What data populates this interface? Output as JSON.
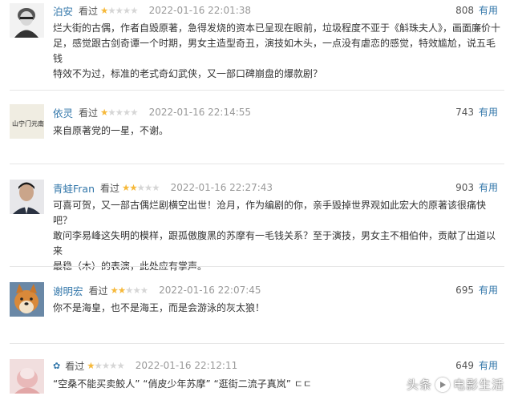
{
  "comments": [
    {
      "username": "泊安",
      "status": "看过",
      "rating": 1,
      "time": "2022-01-16 22:01:38",
      "votes": "808",
      "useful_label": "有用",
      "avatar_icon": "portrait-avatar-icon",
      "lines": [
        "烂大街的古偶，作者自毁原著，急得发烧的资本已呈现在眼前，垃圾程度不亚于《斛珠夫人》，画面廉价十",
        "足，感觉跟古剑奇谭一个时期，男女主造型奇丑，演技如木头，一点没有虐恋的感觉，特效尴尬，说五毛钱",
        "特效不为过，标准的老式奇幻武侠，又一部口碑崩盘的爆款剧？"
      ]
    },
    {
      "username": "依灵",
      "status": "看过",
      "rating": 1,
      "time": "2022-01-16 22:14:55",
      "votes": "743",
      "useful_label": "有用",
      "avatar_icon": "calligraphy-avatar-icon",
      "lines": [
        "来自原著党的一星，不谢。"
      ]
    },
    {
      "username": "青蛙Fran",
      "status": "看过",
      "rating": 2,
      "time": "2022-01-16 22:27:43",
      "votes": "903",
      "useful_label": "有用",
      "avatar_icon": "man-avatar-icon",
      "lines": [
        "可喜可贺，又一部古偶烂剧横空出世！沧月，作为编剧的你，亲手毁掉世界观如此宏大的原著该很痛快吧？",
        "敢问李易峰这失明的模样，跟孤傲腹黑的苏摩有一毛钱关系？至于演技，男女主不相伯仲，贡献了出道以来",
        "最稳（木）的表演，此处应有掌声。"
      ]
    },
    {
      "username": "谢明宏",
      "status": "看过",
      "rating": 2,
      "time": "2022-01-16 22:07:45",
      "votes": "695",
      "useful_label": "有用",
      "avatar_icon": "dog-avatar-icon",
      "lines": [
        "你不是海皇，也不是海王，而是会游泳的灰太狼！"
      ]
    },
    {
      "username": "",
      "status": "看过",
      "rating": 1,
      "time": "2022-01-16 22:12:11",
      "votes": "649",
      "useful_label": "有用",
      "avatar_icon": "pink-avatar-icon",
      "lines": [
        "“空桑不能买卖鲛人” “俏皮少年苏摩” “逛街二流子真岚” ㄷㄷ"
      ]
    }
  ],
  "watermark": {
    "left": "头条",
    "right": "电影生活"
  },
  "colors": {
    "link": "#3377aa",
    "star": "#f6b93b",
    "star_empty": "#d6d6d6"
  }
}
